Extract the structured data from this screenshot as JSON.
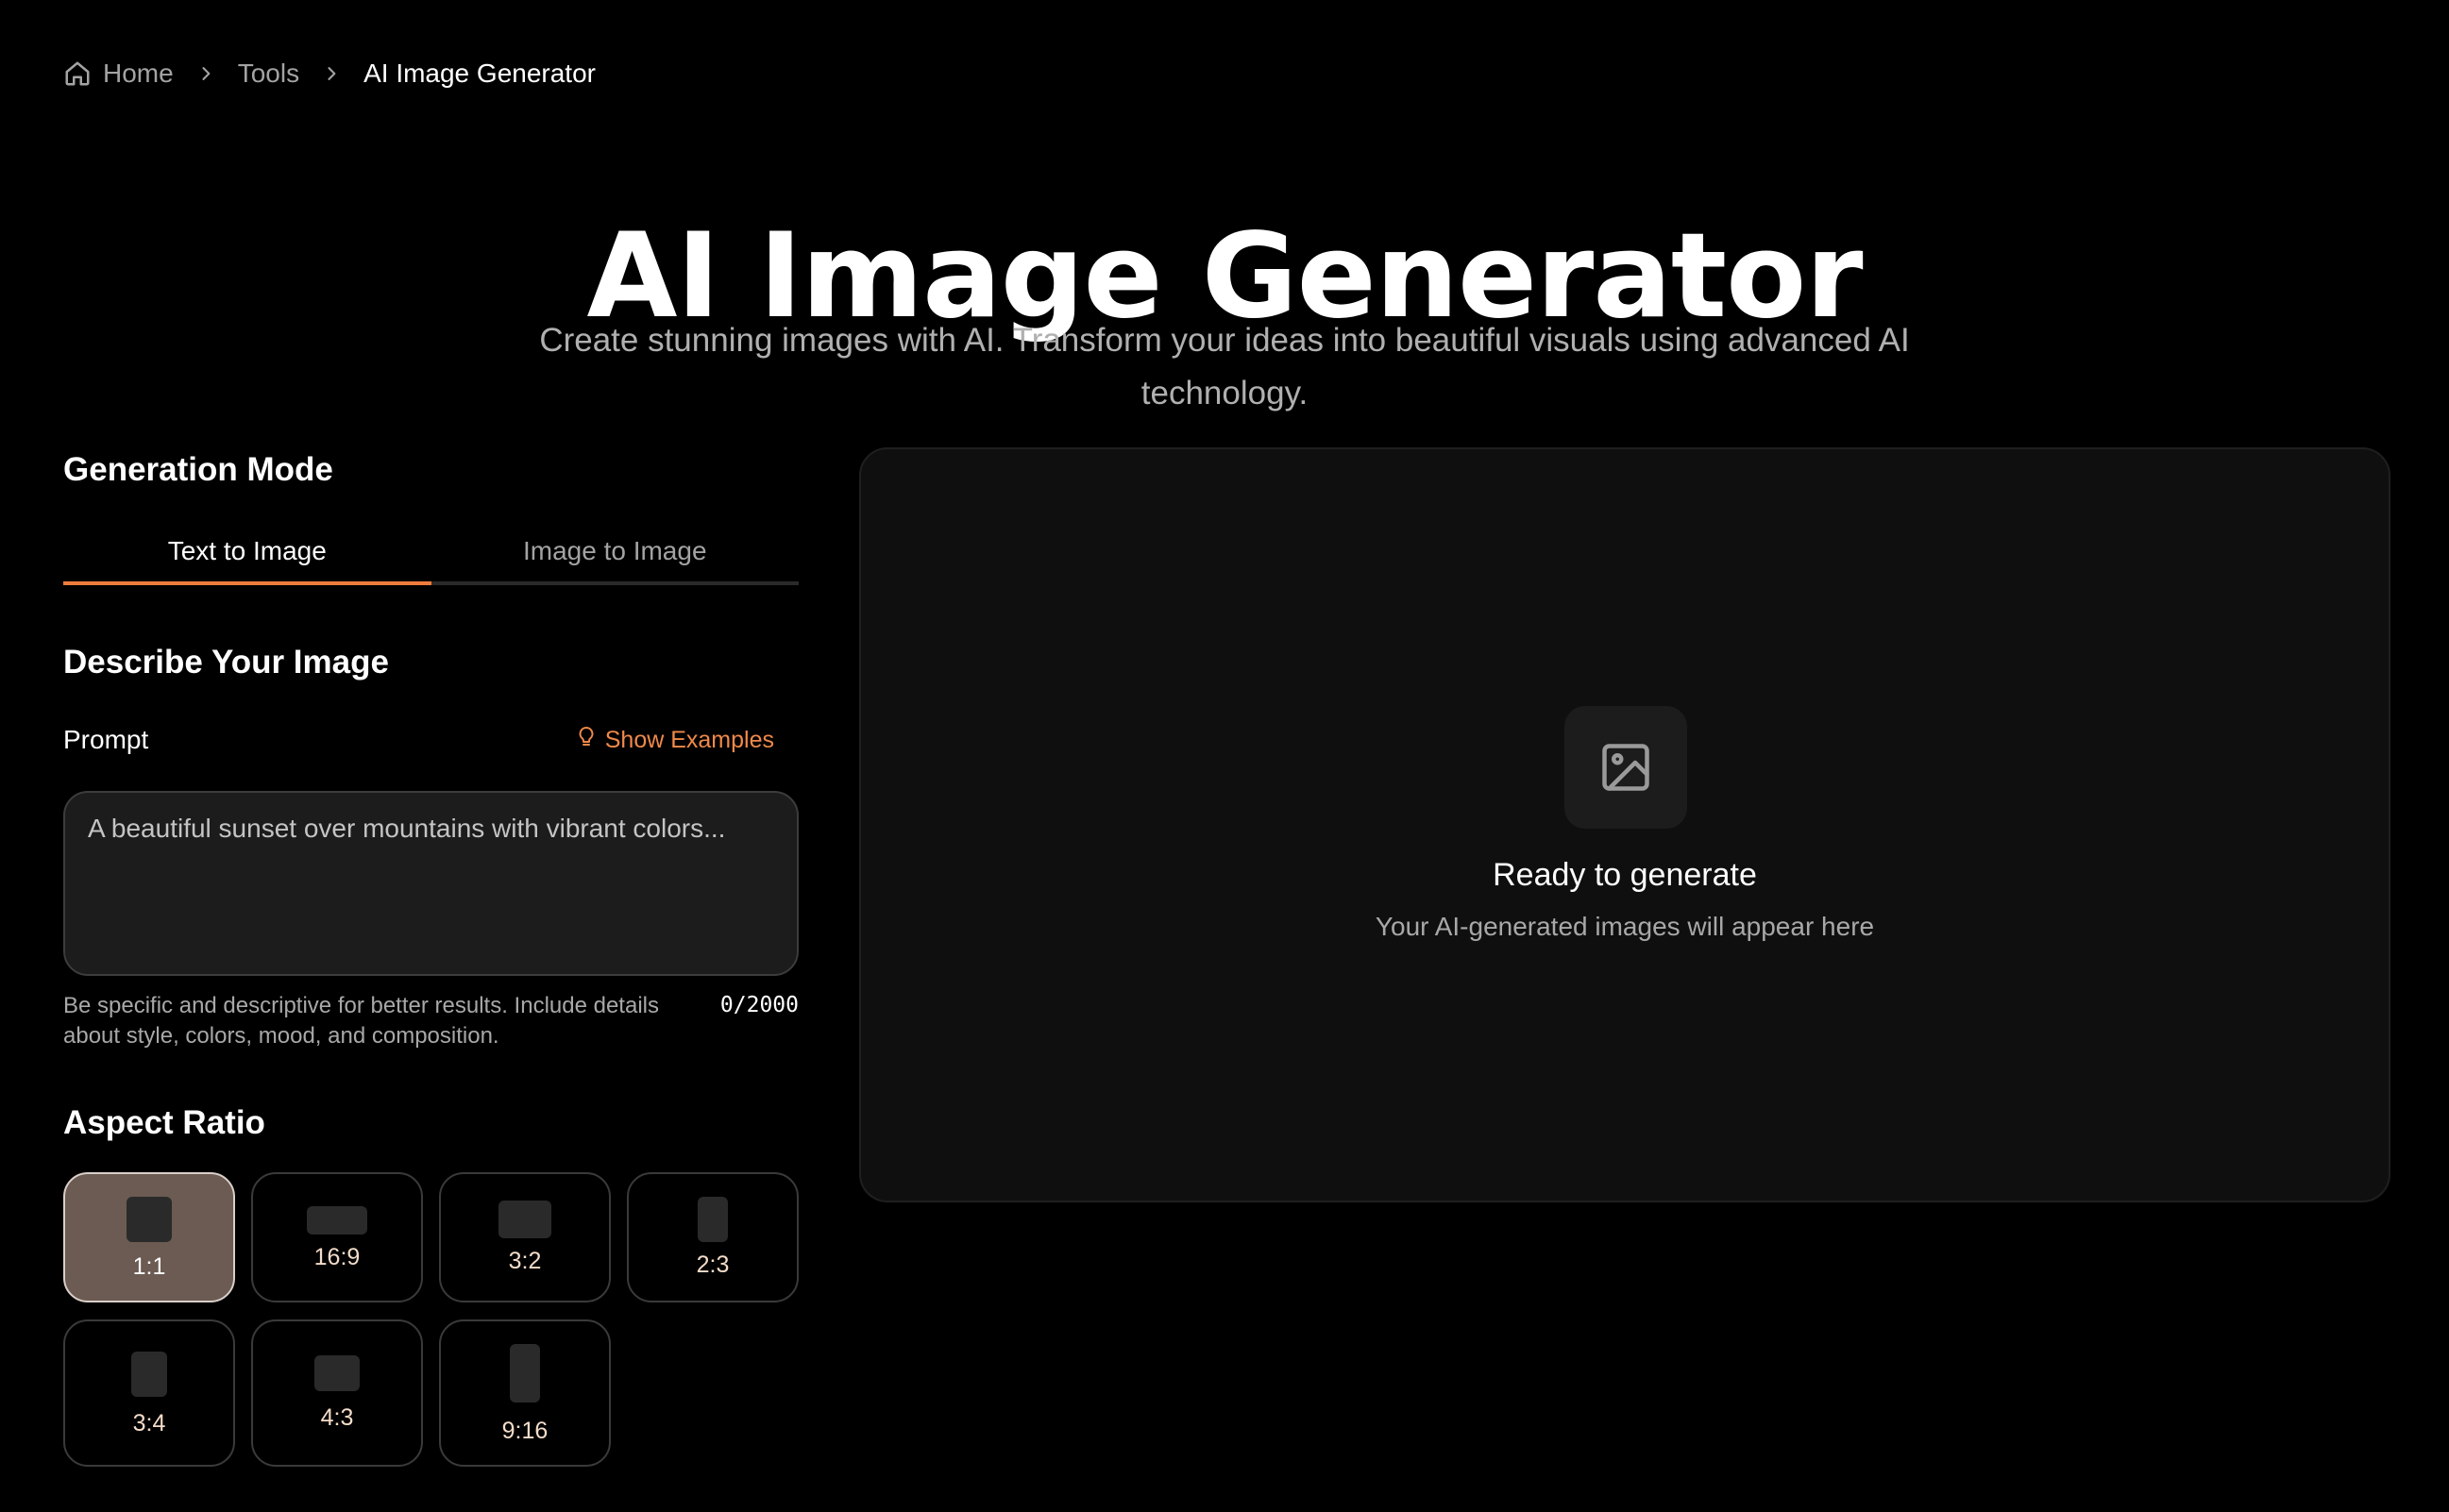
{
  "breadcrumb": {
    "home": "Home",
    "tools": "Tools",
    "current": "AI Image Generator"
  },
  "header": {
    "title": "AI Image Generator",
    "subtitle": "Create stunning images with AI. Transform your ideas into beautiful visuals using advanced AI technology."
  },
  "generation_mode": {
    "title": "Generation Mode",
    "tabs": [
      {
        "label": "Text to Image",
        "active": true
      },
      {
        "label": "Image to Image",
        "active": false
      }
    ]
  },
  "describe": {
    "title": "Describe Your Image",
    "prompt_label": "Prompt",
    "show_examples": "Show Examples",
    "prompt_value": "",
    "prompt_placeholder": "A beautiful sunset over mountains with vibrant colors...",
    "hint": "Be specific and descriptive for better results. Include details about style, colors, mood, and composition.",
    "char_count": "0/2000"
  },
  "aspect_ratio": {
    "title": "Aspect Ratio",
    "selected": "1:1",
    "options": [
      {
        "label": "1:1"
      },
      {
        "label": "16:9"
      },
      {
        "label": "3:2"
      },
      {
        "label": "2:3"
      },
      {
        "label": "3:4"
      },
      {
        "label": "4:3"
      },
      {
        "label": "9:16"
      }
    ]
  },
  "preview": {
    "title": "Ready to generate",
    "subtitle": "Your AI-generated images will appear here"
  },
  "colors": {
    "accent": "#f07c3c",
    "background": "#000000",
    "panel": "#0f0f0f",
    "selected_ratio": "#6b5b52"
  },
  "icons": {
    "home": "home-icon",
    "chevron": "chevron-right-icon",
    "examples": "lightbulb-icon",
    "preview": "image-icon"
  }
}
